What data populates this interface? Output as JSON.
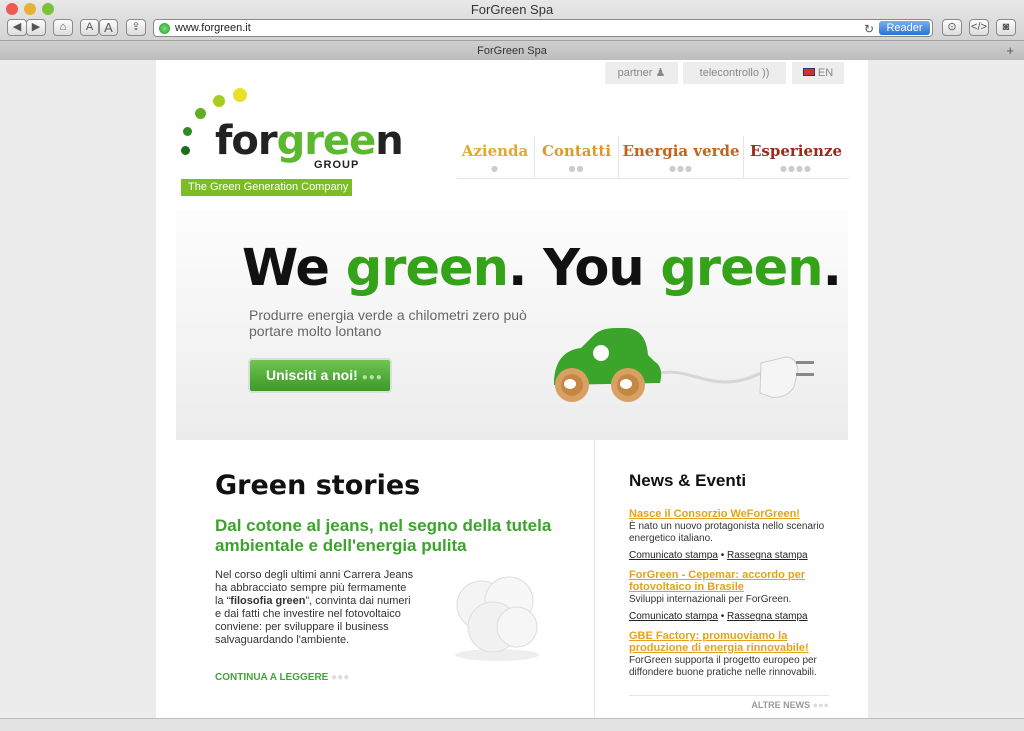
{
  "browser": {
    "window_title": "ForGreen Spa",
    "url": "www.forgreen.it",
    "reader_label": "Reader",
    "tab_title": "ForGreen Spa",
    "font_small_label": "A",
    "font_large_label": "A"
  },
  "utility_nav": {
    "partner": "partner",
    "telecontrollo": "telecontrollo",
    "language": "EN"
  },
  "logo": {
    "brand_prefix": "for",
    "brand_green": "gree",
    "brand_suffix": "n",
    "group": "GROUP",
    "tagline": "The Green Generation Company"
  },
  "nav": {
    "items": [
      {
        "label": "Azienda",
        "dots": "●",
        "color": "#e3a732"
      },
      {
        "label": "Contatti",
        "dots": "●●",
        "color": "#d99a2a"
      },
      {
        "label": "Energia verde",
        "dots": "●●●",
        "color": "#c0651b"
      },
      {
        "label": "Esperienze",
        "dots": "●●●●",
        "color": "#9a2a1a"
      }
    ]
  },
  "hero": {
    "headline_we": "We ",
    "headline_green1": "green",
    "headline_mid": ". You ",
    "headline_green2": "green",
    "headline_end": ".",
    "subtitle": "Produrre energia verde a chilometri zero può portare molto lontano",
    "cta_label": "Unisciti a noi!",
    "cta_more": "●●●"
  },
  "stories": {
    "title": "Green stories",
    "headline": "Dal cotone al jeans, nel segno della tutela ambientale e dell'energia pulita",
    "body_before": "Nel corso degli ultimi anni Carrera Jeans ha abbracciato sempre più fermamente la “",
    "body_bold": "filosofia green",
    "body_after": "”, convinta dai numeri e dai fatti che investire nel fotovoltaico conviene: per sviluppare il business salvaguardando l'ambiente.",
    "continue_label": "CONTINUA A LEGGERE",
    "continue_dots": "●●●"
  },
  "news": {
    "title": "News & Eventi",
    "items": [
      {
        "title": "Nasce il Consorzio WeForGreen!",
        "desc": "È nato un nuovo protagonista nello scenario energetico italiano.",
        "link1": "Comunicato stampa",
        "link2": "Rassegna stampa"
      },
      {
        "title": "ForGreen - Cepemar: accordo per fotovoltaico in Brasile",
        "desc": "Sviluppi internazionali per ForGreen.",
        "link1": "Comunicato stampa",
        "link2": "Rassegna stampa"
      },
      {
        "title": "GBE Factory: promuoviamo la produzione di energia rinnovabile!",
        "desc": "ForGreen supporta il progetto europeo per diffondere buone pratiche nelle rinnovabili."
      }
    ],
    "more_label": "ALTRE NEWS",
    "more_dots": "●●●"
  },
  "colors": {
    "brand_green": "#5cb82e",
    "headline_green": "#34a31a",
    "news_link": "#e3a21a"
  }
}
